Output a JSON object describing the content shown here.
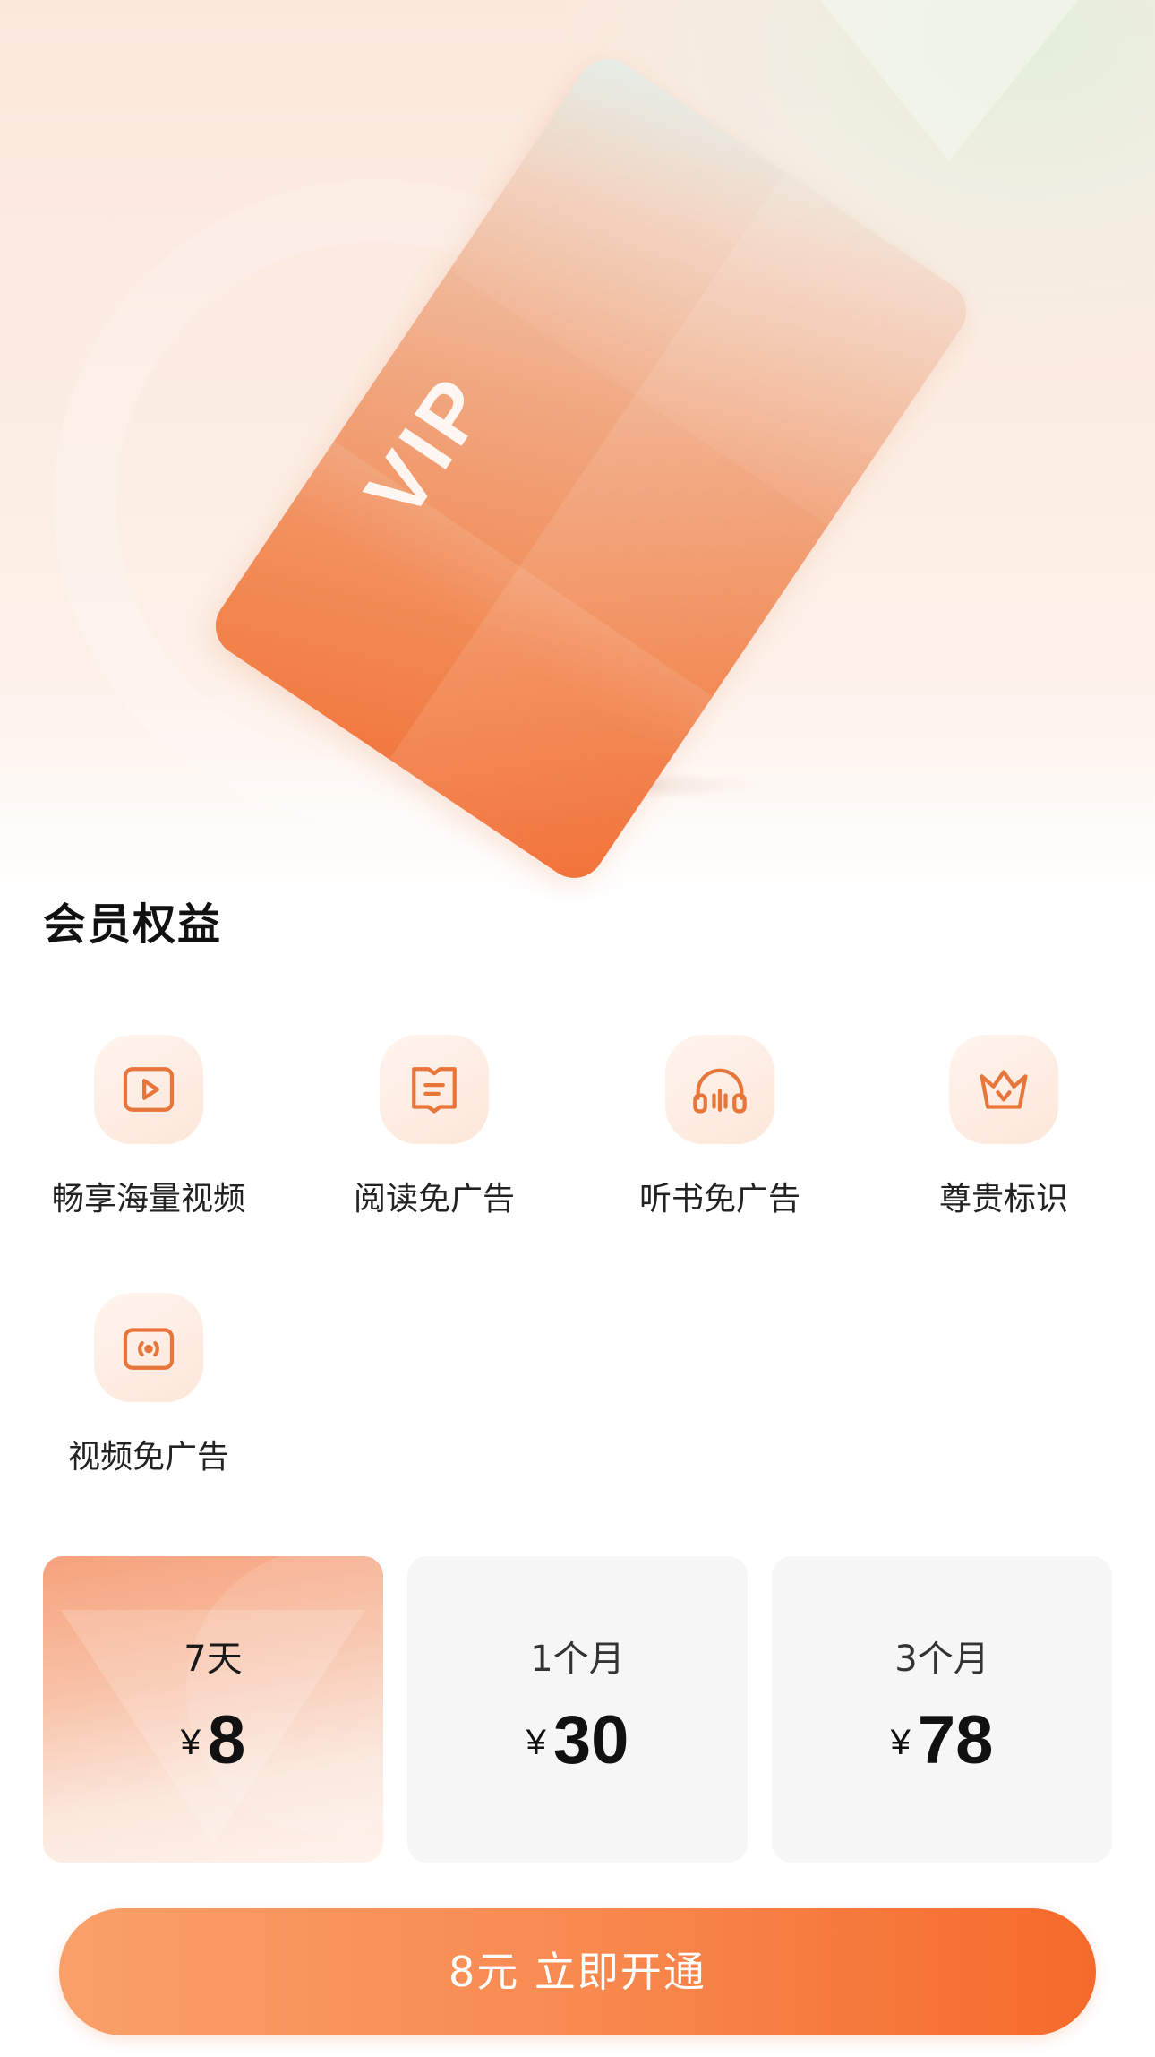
{
  "card": {
    "logo_text": "VIP"
  },
  "benefits": {
    "title": "会员权益",
    "items": [
      {
        "label": "畅享海量视频",
        "icon": "play-video-icon"
      },
      {
        "label": "阅读免广告",
        "icon": "book-icon"
      },
      {
        "label": "听书免广告",
        "icon": "headphones-icon"
      },
      {
        "label": "尊贵标识",
        "icon": "crown-badge-icon"
      },
      {
        "label": "视频免广告",
        "icon": "broadcast-screen-icon"
      }
    ]
  },
  "plans": [
    {
      "duration": "7天",
      "currency": "¥",
      "price": "8",
      "selected": true
    },
    {
      "duration": "1个月",
      "currency": "¥",
      "price": "30",
      "selected": false
    },
    {
      "duration": "3个月",
      "currency": "¥",
      "price": "78",
      "selected": false
    }
  ],
  "cta": {
    "label": "8元 立即开通"
  },
  "colors": {
    "accent": "#f57a3c",
    "icon_stroke": "#e8763a",
    "plan_bg": "#f6f6f6"
  }
}
